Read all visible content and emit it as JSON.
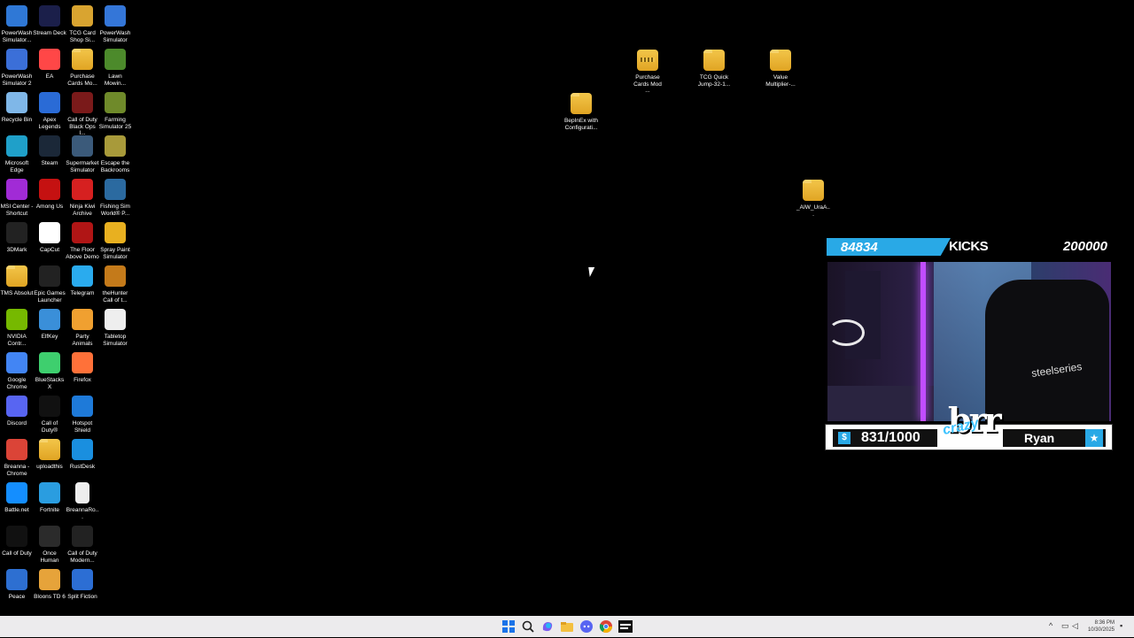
{
  "desktop": {
    "col1": [
      {
        "label": "PowerWash Simulator...",
        "icon": "powerwash-icon",
        "color": "#2f78d6"
      },
      {
        "label": "PowerWash Simulator 2",
        "icon": "powerwash2-icon",
        "color": "#3b6fd8"
      },
      {
        "label": "Recycle Bin",
        "icon": "recycle-bin-icon",
        "color": "#7fb7e8"
      },
      {
        "label": "Microsoft Edge",
        "icon": "edge-icon",
        "color": "#1fa0c9"
      },
      {
        "label": "MSI Center - Shortcut",
        "icon": "msi-center-icon",
        "color": "#a12bd6"
      },
      {
        "label": "3DMark",
        "icon": "3dmark-icon",
        "color": "#222222"
      },
      {
        "label": "TMS Absolut",
        "icon": "folder-icon",
        "color": "#f0c040"
      },
      {
        "label": "NVIDIA Contr...",
        "icon": "nvidia-icon",
        "color": "#76b900"
      },
      {
        "label": "Google Chrome",
        "icon": "chrome-icon",
        "color": "#4285f4"
      },
      {
        "label": "Discord",
        "icon": "discord-icon",
        "color": "#5865f2"
      },
      {
        "label": "Breanna - Chrome",
        "icon": "chrome-profile-icon",
        "color": "#db4437"
      },
      {
        "label": "Battle.net",
        "icon": "battlenet-icon",
        "color": "#148eff"
      },
      {
        "label": "Call of Duty",
        "icon": "call-of-duty-icon",
        "color": "#111111"
      },
      {
        "label": "Peace",
        "icon": "peace-icon",
        "color": "#2d6fd1"
      }
    ],
    "col2": [
      {
        "label": "Stream Deck",
        "icon": "stream-deck-icon",
        "color": "#1b1f4a"
      },
      {
        "label": "EA",
        "icon": "ea-icon",
        "color": "#ff4747"
      },
      {
        "label": "Apex Legends",
        "icon": "apex-icon",
        "color": "#2a6bd6"
      },
      {
        "label": "Steam",
        "icon": "steam-icon",
        "color": "#1b2838"
      },
      {
        "label": "Among Us",
        "icon": "among-us-icon",
        "color": "#c51111"
      },
      {
        "label": "CapCut",
        "icon": "capcut-icon",
        "color": "#ffffff"
      },
      {
        "label": "Epic Games Launcher",
        "icon": "epic-games-icon",
        "color": "#222222"
      },
      {
        "label": "ElfKey",
        "icon": "elfkey-icon",
        "color": "#3a8fd9"
      },
      {
        "label": "BlueStacks X",
        "icon": "bluestacks-icon",
        "color": "#3ecf6e"
      },
      {
        "label": "Call of Duty®",
        "icon": "call-of-duty-icon",
        "color": "#111111"
      },
      {
        "label": "uploadthis",
        "icon": "folder-icon",
        "color": "#f0c040"
      },
      {
        "label": "Fortnite",
        "icon": "fortnite-icon",
        "color": "#2a9de0"
      },
      {
        "label": "Once Human",
        "icon": "once-human-icon",
        "color": "#2b2b2b"
      },
      {
        "label": "Bloons TD 6",
        "icon": "bloons-icon",
        "color": "#e6a33a"
      }
    ],
    "col3": [
      {
        "label": "TCG Card Shop Si...",
        "icon": "tcg-card-shop-icon",
        "color": "#d9a430"
      },
      {
        "label": "Purchase Cards Mo...",
        "icon": "folder-icon",
        "color": "#f0c040"
      },
      {
        "label": "Call of Duty Black Ops I...",
        "icon": "cod-black-ops-icon",
        "color": "#7a1a1a"
      },
      {
        "label": "Supermarket Simulator",
        "icon": "supermarket-icon",
        "color": "#3b5a7a"
      },
      {
        "label": "Ninja Kiwi Archive",
        "icon": "ninja-kiwi-icon",
        "color": "#d62020"
      },
      {
        "label": "The Floor Above Demo",
        "icon": "floor-above-icon",
        "color": "#b01515"
      },
      {
        "label": "Telegram",
        "icon": "telegram-icon",
        "color": "#2aabee"
      },
      {
        "label": "Party Animals",
        "icon": "party-animals-icon",
        "color": "#f0a030"
      },
      {
        "label": "Firefox",
        "icon": "firefox-icon",
        "color": "#ff7139"
      },
      {
        "label": "Hotspot Shield",
        "icon": "hotspot-shield-icon",
        "color": "#1e7ad9"
      },
      {
        "label": "RustDesk",
        "icon": "rustdesk-icon",
        "color": "#1a8fdf"
      },
      {
        "label": "BreannaRo...",
        "icon": "document-icon",
        "color": "#eeeeee"
      },
      {
        "label": "Call of Duty Modern...",
        "icon": "cod-mw2-icon",
        "color": "#222222"
      },
      {
        "label": "Split Fiction",
        "icon": "split-fiction-icon",
        "color": "#2c6ed4"
      }
    ],
    "col4": [
      {
        "label": "PowerWash Simulator",
        "icon": "powerwash-icon",
        "color": "#3476d8"
      },
      {
        "label": "Lawn Mowin...",
        "icon": "lawn-mowing-icon",
        "color": "#4c8a2b"
      },
      {
        "label": "Farming Simulator 25",
        "icon": "farming-sim-icon",
        "color": "#6f8a2a"
      },
      {
        "label": "Escape the Backrooms",
        "icon": "backrooms-icon",
        "color": "#a89a3a"
      },
      {
        "label": "Fishing Sim World® P...",
        "icon": "fishing-sim-icon",
        "color": "#2b6aa0"
      },
      {
        "label": "Spray Paint Simulator",
        "icon": "spray-paint-icon",
        "color": "#e8b020"
      },
      {
        "label": "theHunter Call of t...",
        "icon": "thehunter-icon",
        "color": "#c47a1a"
      },
      {
        "label": "Tabletop Simulator",
        "icon": "tabletop-icon",
        "color": "#eeeeee"
      }
    ],
    "loose": [
      {
        "label": "Purchase Cards Mod ...",
        "icon": "zip-folder-icon"
      },
      {
        "label": "TCG Quick Jump-32-1...",
        "icon": "folder-icon"
      },
      {
        "label": "Value Multiplier-...",
        "icon": "folder-icon"
      },
      {
        "label": "BepInEx with Configurati...",
        "icon": "folder-icon"
      },
      {
        "label": "_AIW_UraA...",
        "icon": "folder-icon"
      }
    ]
  },
  "overlay": {
    "viewers": "84834",
    "kicks_label": "KICKS",
    "goal": "200000",
    "sub_count": "831/1000",
    "streamer_name": "Ryan",
    "logo_text": "brr",
    "logo_script": "crazy",
    "dollar_glyph": "$",
    "star_glyph": "★",
    "webcam_brand": "steelseries"
  },
  "taskbar": {
    "time": "8:36 PM",
    "date": "10/30/2025",
    "apps": [
      "start-icon",
      "search-icon",
      "copilot-icon",
      "file-explorer-icon",
      "discord-icon",
      "chrome-icon",
      "cod-icon"
    ]
  }
}
